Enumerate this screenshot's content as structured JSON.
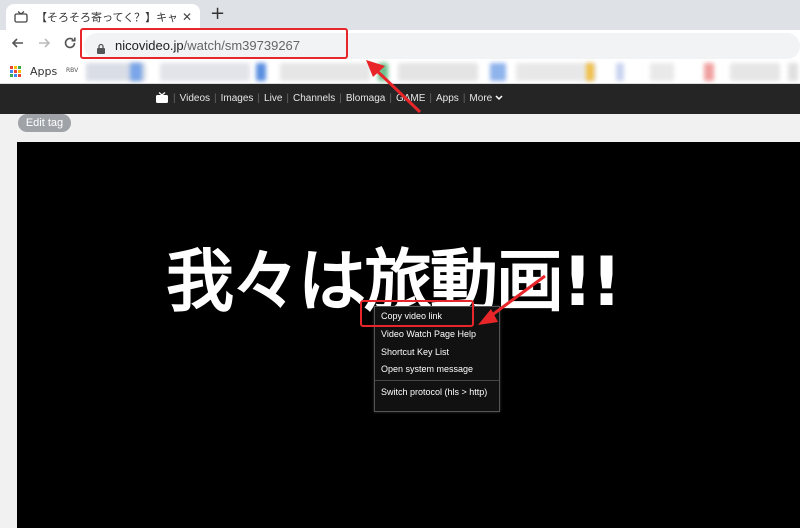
{
  "browser": {
    "tab_title": "【そろそろ寄ってく？】キャン",
    "close_glyph": "✕",
    "new_tab_glyph": "+",
    "url_host": "nicovideo.jp",
    "url_path": "/watch/sm39739267",
    "bookmarks_apps_label": "Apps",
    "bookmark_small": "RBV"
  },
  "site_nav": {
    "items": [
      "Videos",
      "Images",
      "Live",
      "Channels",
      "Blomaga",
      "GAME",
      "Apps",
      "More"
    ]
  },
  "page": {
    "edit_tag_label": "Edit tag",
    "video_overlay_text": "我々は旅動画!!"
  },
  "context_menu": {
    "items": [
      "Copy video link",
      "Video Watch Page Help",
      "Shortcut Key List",
      "Open system message",
      "Switch protocol (hls > http)"
    ]
  },
  "colors": {
    "annotation_red": "#e8262a",
    "nico_bar": "#252525"
  }
}
